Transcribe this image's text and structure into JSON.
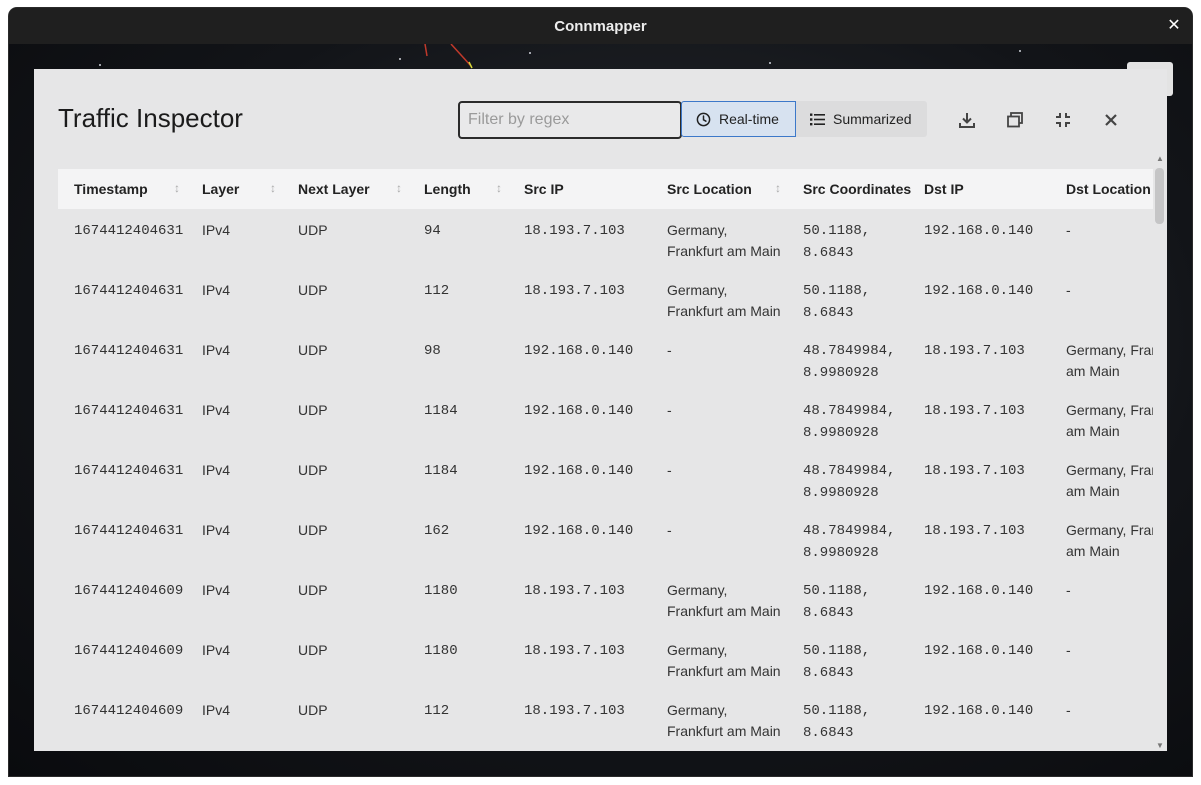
{
  "window": {
    "title": "Connmapper",
    "close_glyph": "✕"
  },
  "panel": {
    "title": "Traffic Inspector",
    "filter_placeholder": "Filter by regex",
    "modes": [
      {
        "label": "Real-time",
        "icon": "clock-icon",
        "active": true
      },
      {
        "label": "Summarized",
        "icon": "list-icon",
        "active": false
      }
    ],
    "tools": [
      "download-icon",
      "window-restore-icon",
      "collapse-icon",
      "close-icon"
    ]
  },
  "table": {
    "columns": [
      "Timestamp",
      "Layer",
      "Next Layer",
      "Length",
      "Src IP",
      "Src Location",
      "Src Coordinates",
      "Dst IP",
      "Dst Location"
    ],
    "rows": [
      [
        "1674412404631",
        "IPv4",
        "UDP",
        "94",
        "18.193.7.103",
        "Germany, Frankfurt am Main",
        "50.1188, 8.6843",
        "192.168.0.140",
        "-"
      ],
      [
        "1674412404631",
        "IPv4",
        "UDP",
        "112",
        "18.193.7.103",
        "Germany, Frankfurt am Main",
        "50.1188, 8.6843",
        "192.168.0.140",
        "-"
      ],
      [
        "1674412404631",
        "IPv4",
        "UDP",
        "98",
        "192.168.0.140",
        "-",
        "48.7849984, 8.9980928",
        "18.193.7.103",
        "Germany, Frankfurt am Main"
      ],
      [
        "1674412404631",
        "IPv4",
        "UDP",
        "1184",
        "192.168.0.140",
        "-",
        "48.7849984, 8.9980928",
        "18.193.7.103",
        "Germany, Frankfurt am Main"
      ],
      [
        "1674412404631",
        "IPv4",
        "UDP",
        "1184",
        "192.168.0.140",
        "-",
        "48.7849984, 8.9980928",
        "18.193.7.103",
        "Germany, Frankfurt am Main"
      ],
      [
        "1674412404631",
        "IPv4",
        "UDP",
        "162",
        "192.168.0.140",
        "-",
        "48.7849984, 8.9980928",
        "18.193.7.103",
        "Germany, Frankfurt am Main"
      ],
      [
        "1674412404609",
        "IPv4",
        "UDP",
        "1180",
        "18.193.7.103",
        "Germany, Frankfurt am Main",
        "50.1188, 8.6843",
        "192.168.0.140",
        "-"
      ],
      [
        "1674412404609",
        "IPv4",
        "UDP",
        "1180",
        "18.193.7.103",
        "Germany, Frankfurt am Main",
        "50.1188, 8.6843",
        "192.168.0.140",
        "-"
      ],
      [
        "1674412404609",
        "IPv4",
        "UDP",
        "112",
        "18.193.7.103",
        "Germany, Frankfurt am Main",
        "50.1188, 8.6843",
        "192.168.0.140",
        "-"
      ]
    ]
  },
  "colors": {
    "accent": "#3c78c9",
    "panel_bg": "#e6e6e7",
    "header_bg": "#f4f4f5",
    "titlebar": "#1f1f1f"
  }
}
